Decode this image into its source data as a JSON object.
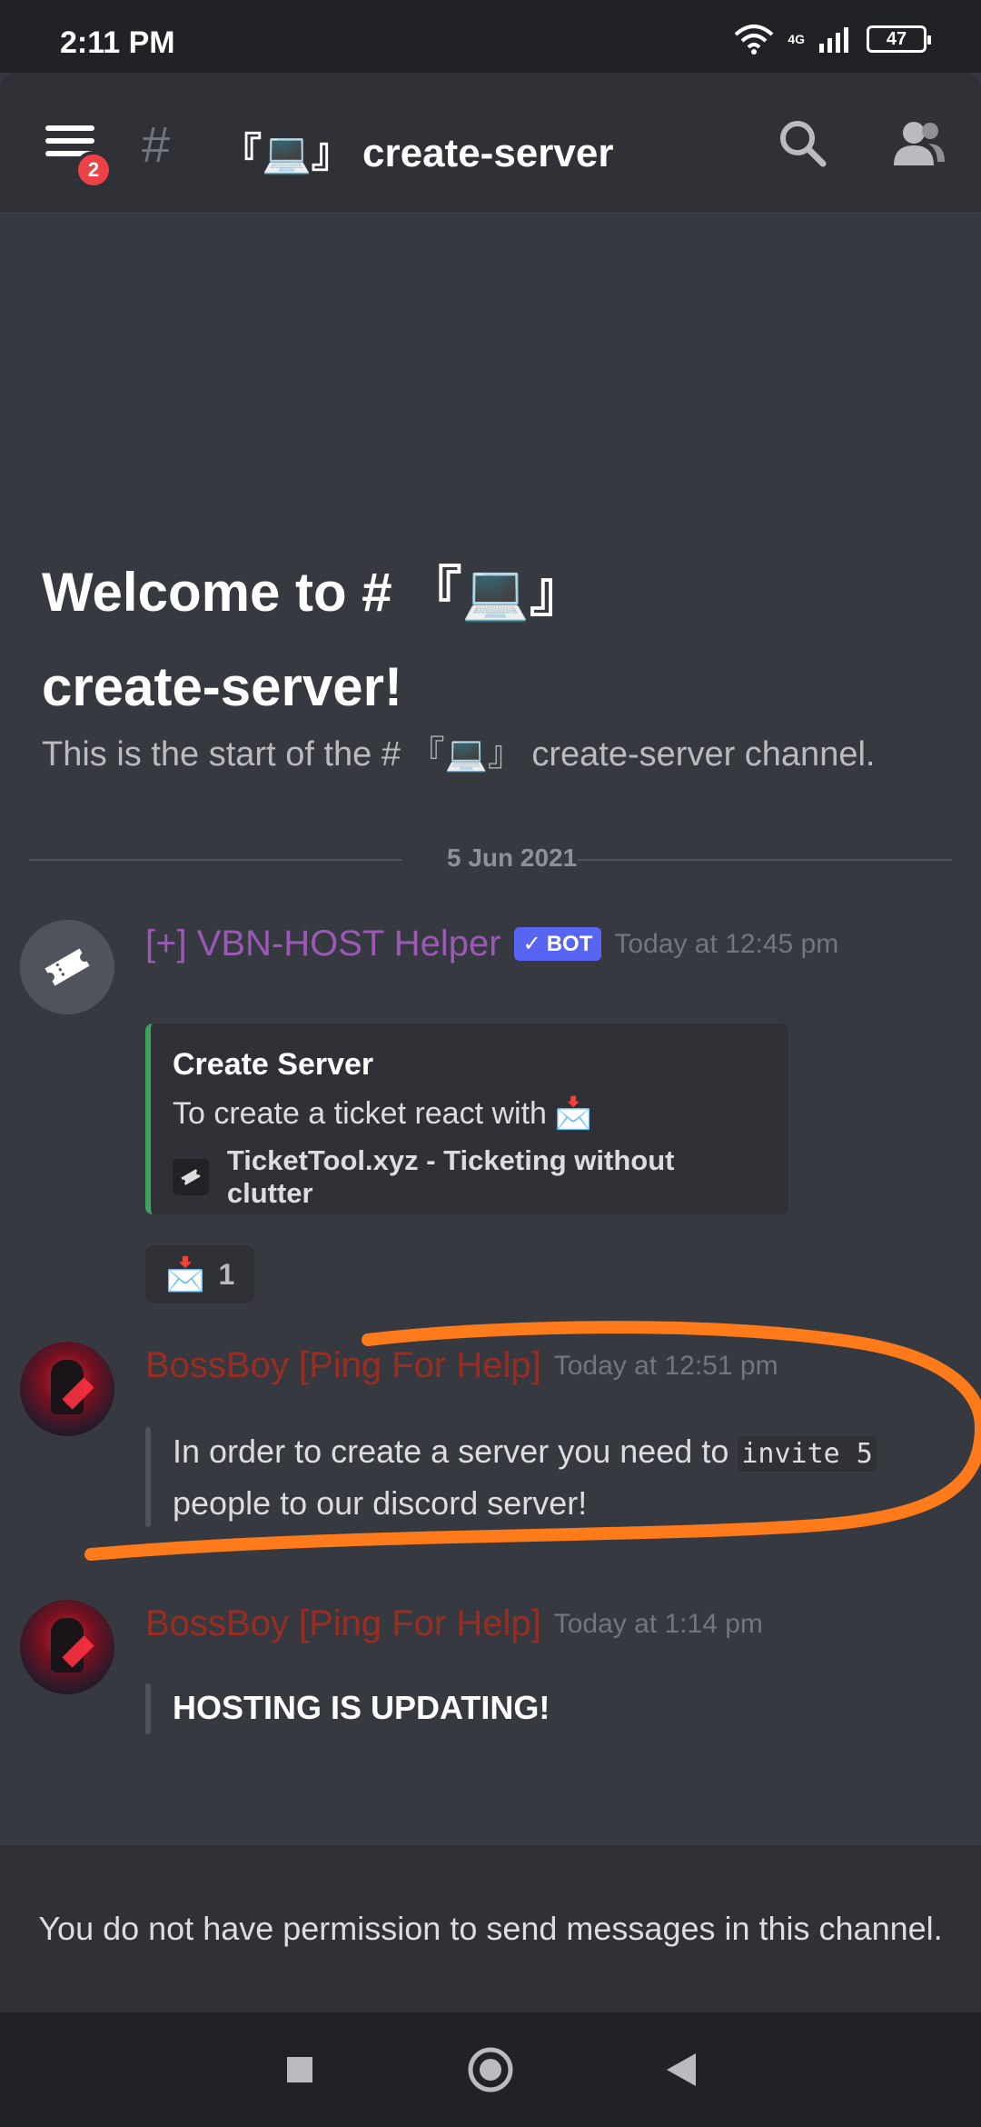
{
  "status_bar": {
    "time": "2:11 PM",
    "network": "4G",
    "battery": "47"
  },
  "header": {
    "badge_count": "2",
    "channel_prefix": "#",
    "channel_name": "『💻』 create-server"
  },
  "welcome": {
    "title_line1": "Welcome to # 『💻』",
    "title_line2": "create-server!",
    "subtitle": "This is the start of the # 『💻』 create-server channel."
  },
  "divider": {
    "date": "5 Jun 2021"
  },
  "messages": [
    {
      "author": "[+] VBN-HOST Helper",
      "bot_tag": "BOT",
      "timestamp": "Today at 12:45 pm",
      "embed": {
        "title": "Create Server",
        "description": "To create a ticket react with",
        "footer": "TicketTool.xyz - Ticketing without clutter"
      },
      "reaction": {
        "count": "1"
      }
    },
    {
      "author": "BossBoy [Ping For Help]",
      "timestamp": "Today at 12:51 pm",
      "text_before": "In order to create a server you need to ",
      "code": "invite 5",
      "text_after": "people to our discord server!"
    },
    {
      "author": "BossBoy [Ping For Help]",
      "timestamp": "Today at 1:14 pm",
      "text": "HOSTING IS UPDATING!"
    }
  ],
  "footer": {
    "permission_text": "You do not have permission to send messages in this channel."
  },
  "colors": {
    "background": "#36393f",
    "header": "#2f3136",
    "bot_author": "#9b59b6",
    "user_author": "#992d22",
    "embed_accent": "#3ba55c",
    "blurple": "#5865f2",
    "annotation": "#ff7a1a"
  }
}
